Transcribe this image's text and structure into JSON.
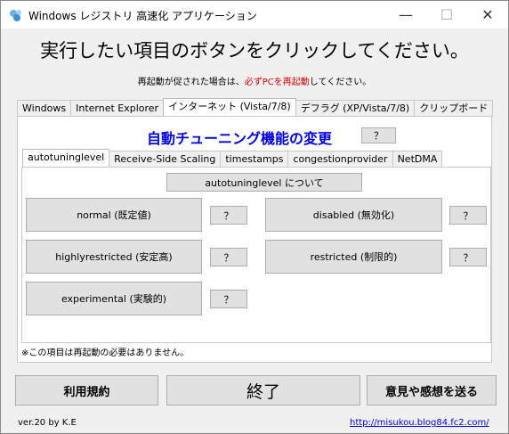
{
  "window": {
    "title": "Windows レジストリ 高速化 アプリケーション",
    "minimize_glyph": "—",
    "maximize_glyph": "☐",
    "close_glyph": "✕"
  },
  "header": {
    "headline": "実行したい項目のボタンをクリックしてください。",
    "subline_prefix": "再起動が促された場合は、",
    "subline_red": "必ずPCを再起動",
    "subline_suffix": "してください。"
  },
  "top_tabs": [
    {
      "label": "Windows"
    },
    {
      "label": "Internet Explorer"
    },
    {
      "label": "インターネット (Vista/7/8)"
    },
    {
      "label": "デフラグ (XP/Vista/7/8)"
    },
    {
      "label": "クリップボード"
    }
  ],
  "section": {
    "title": "自動チューニング機能の変更",
    "help_label": "？"
  },
  "inner_tabs": [
    {
      "label": "autotuninglevel"
    },
    {
      "label": "Receive-Side Scaling"
    },
    {
      "label": "timestamps"
    },
    {
      "label": "congestionprovider"
    },
    {
      "label": "NetDMA"
    }
  ],
  "about_button": "autotuninglevel について",
  "options": {
    "normal": "normal (既定値)",
    "disabled": "disabled (無効化)",
    "highlyrestricted": "highlyrestricted (安定高)",
    "restricted": "restricted (制限的)",
    "experimental": "experimental (実験的)",
    "help": "？"
  },
  "note": "※この項目は再起動の必要はありません。",
  "bottom": {
    "terms": "利用規約",
    "exit": "終了",
    "feedback": "意見や感想を送る"
  },
  "footer": {
    "version": "ver.20 by K.E",
    "link": "http://misukou.blog84.fc2.com/"
  }
}
